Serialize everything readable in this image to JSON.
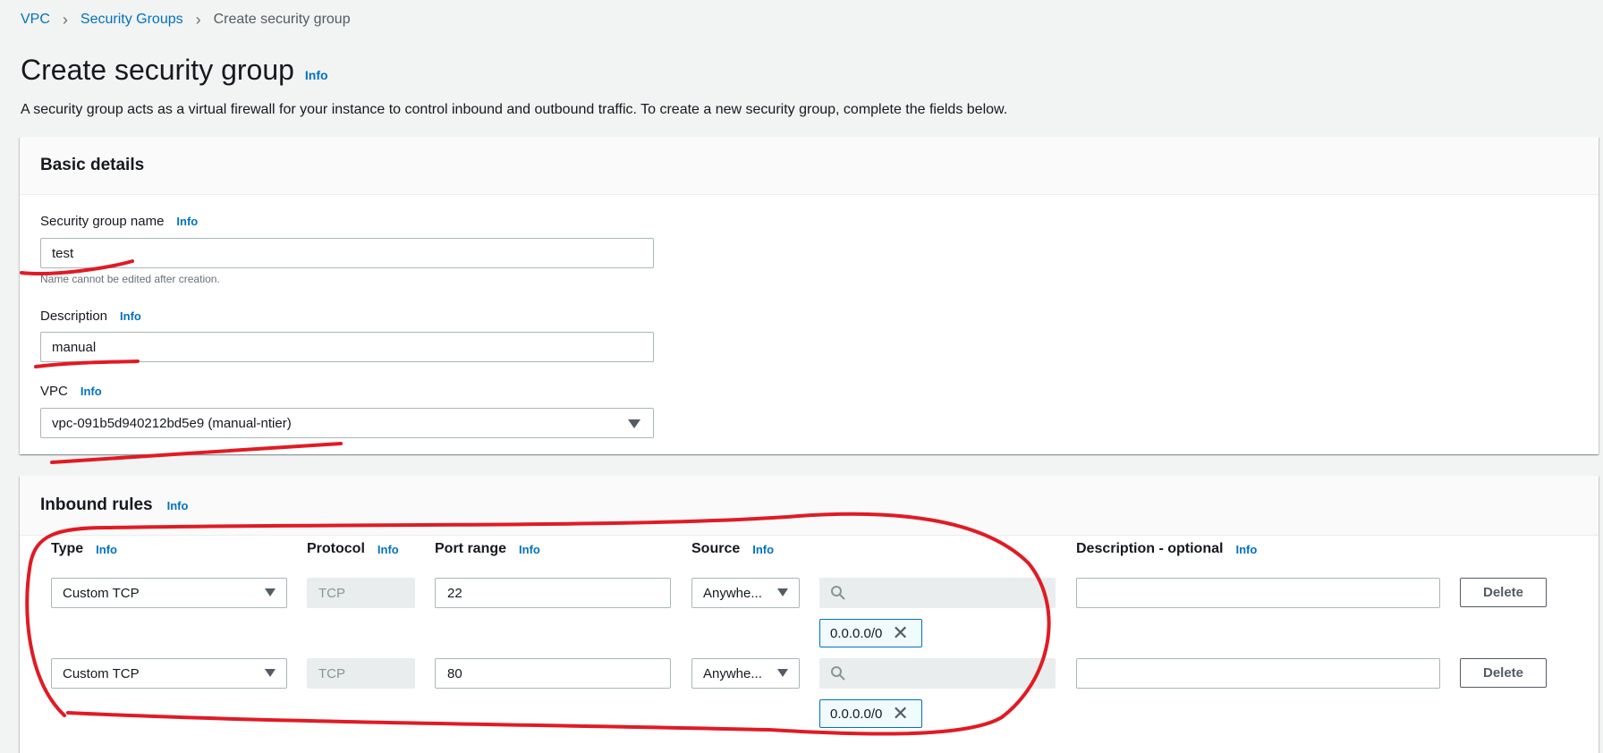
{
  "breadcrumb": {
    "vpc": "VPC",
    "security_groups": "Security Groups",
    "current": "Create security group"
  },
  "header": {
    "title": "Create security group",
    "info": "Info",
    "description": "A security group acts as a virtual firewall for your instance to control inbound and outbound traffic. To create a new security group, complete the fields below."
  },
  "basic": {
    "title": "Basic details",
    "name_label": "Security group name",
    "name_value": "test",
    "name_hint": "Name cannot be edited after creation.",
    "desc_label": "Description",
    "desc_value": "manual",
    "vpc_label": "VPC",
    "vpc_value": "vpc-091b5d940212bd5e9 (manual-ntier)",
    "info": "Info"
  },
  "inbound": {
    "title": "Inbound rules",
    "info": "Info",
    "columns": {
      "type": "Type",
      "protocol": "Protocol",
      "port_range": "Port range",
      "source": "Source",
      "description": "Description - optional"
    },
    "rules": [
      {
        "type": "Custom TCP",
        "protocol": "TCP",
        "port": "22",
        "source": "Anywhe...",
        "cidr": "0.0.0.0/0",
        "delete": "Delete"
      },
      {
        "type": "Custom TCP",
        "protocol": "TCP",
        "port": "80",
        "source": "Anywhe...",
        "cidr": "0.0.0.0/0",
        "delete": "Delete"
      }
    ]
  },
  "icons": {
    "separator": "chevron-right-icon",
    "caret": "caret-down-icon",
    "search": "search-icon",
    "remove": "close-icon"
  },
  "colors": {
    "link": "#0073bb",
    "annotation": "#e01b24",
    "background": "#f2f3f3"
  }
}
